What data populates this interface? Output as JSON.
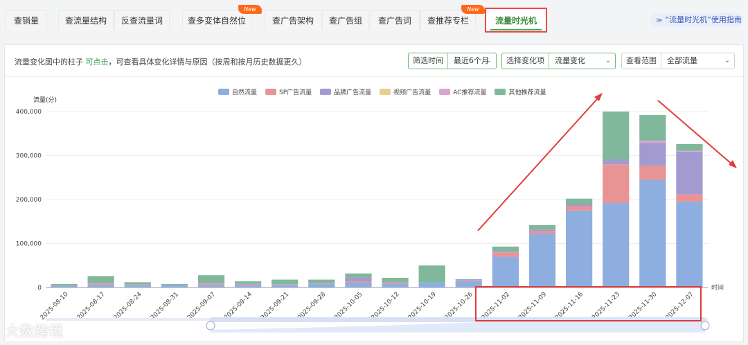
{
  "tabs": [
    {
      "label": "查销量"
    },
    {
      "label": "查流量结构"
    },
    {
      "label": "反查流量词"
    },
    {
      "label": "查多变体自然位",
      "badge": "New"
    },
    {
      "label": "查广告架构"
    },
    {
      "label": "查广告组"
    },
    {
      "label": "查广告词"
    },
    {
      "label": "查推荐专栏",
      "badge": "New"
    },
    {
      "label": "流量时光机",
      "active": true
    }
  ],
  "guide": {
    "chevron": "≫",
    "label": "“流量时光机”使用指南"
  },
  "hint": {
    "prefix": "流量变化图中的柱子 ",
    "link": "可点击",
    "suffix": "，可查看具体变化详情与原因（按周和按月历史数据更久）"
  },
  "filters": [
    {
      "label": "筛选时间",
      "value": "最近6个月"
    },
    {
      "label": "选择变化项",
      "value": "流量变化"
    },
    {
      "label": "查看范围",
      "value": "全部流量"
    }
  ],
  "chart_data": {
    "type": "bar",
    "stacked": true,
    "ylabel": "流量(分)",
    "xlabel": "时间",
    "ylim": [
      0,
      400000
    ],
    "yticks": [
      "0",
      "100,000",
      "200,000",
      "300,000",
      "400,000"
    ],
    "legend_position": "top",
    "categories": [
      "2025-08-10",
      "2025-08-17",
      "2025-08-24",
      "2025-08-31",
      "2025-09-07",
      "2025-09-14",
      "2025-09-21",
      "2025-09-28",
      "2025-10-05",
      "2025-10-12",
      "2025-10-19",
      "2025-10-26",
      "2025-11-02",
      "2025-11-09",
      "2025-11-16",
      "2025-11-23",
      "2025-11-30",
      "2025-12-07"
    ],
    "series": [
      {
        "name": "自然流量",
        "color": "#8eaee0",
        "values": [
          4000,
          6000,
          5000,
          6000,
          6000,
          6000,
          6000,
          8000,
          11000,
          8000,
          12000,
          15000,
          70000,
          122000,
          175000,
          192000,
          245000,
          195000
        ]
      },
      {
        "name": "SP广告流量",
        "color": "#e89494",
        "values": [
          500,
          3000,
          1000,
          0,
          3000,
          2000,
          1000,
          1000,
          3000,
          2000,
          0,
          2000,
          10000,
          6000,
          10000,
          88000,
          32000,
          17000
        ]
      },
      {
        "name": "品牌广告流量",
        "color": "#a39ad0",
        "values": [
          0,
          1000,
          500,
          0,
          1000,
          500,
          500,
          2000,
          9000,
          2000,
          0,
          1000,
          3000,
          4000,
          4000,
          12000,
          52000,
          97000
        ]
      },
      {
        "name": "视频广告流量",
        "color": "#e8cf8e",
        "values": [
          0,
          0,
          0,
          0,
          0,
          0,
          0,
          0,
          0,
          0,
          0,
          0,
          0,
          0,
          0,
          0,
          0,
          0
        ]
      },
      {
        "name": "AC推荐流量",
        "color": "#d9a6d2",
        "values": [
          0,
          0,
          0,
          0,
          0,
          0,
          0,
          0,
          0,
          0,
          0,
          0,
          0,
          0,
          0,
          0,
          5000,
          2000
        ]
      },
      {
        "name": "其他推荐流量",
        "color": "#7fb89a",
        "values": [
          3500,
          16000,
          5500,
          2000,
          18000,
          5500,
          10500,
          7000,
          9000,
          10000,
          38000,
          1000,
          10000,
          10000,
          13000,
          108000,
          58000,
          15000
        ]
      }
    ]
  },
  "watermark": "大数跨境"
}
